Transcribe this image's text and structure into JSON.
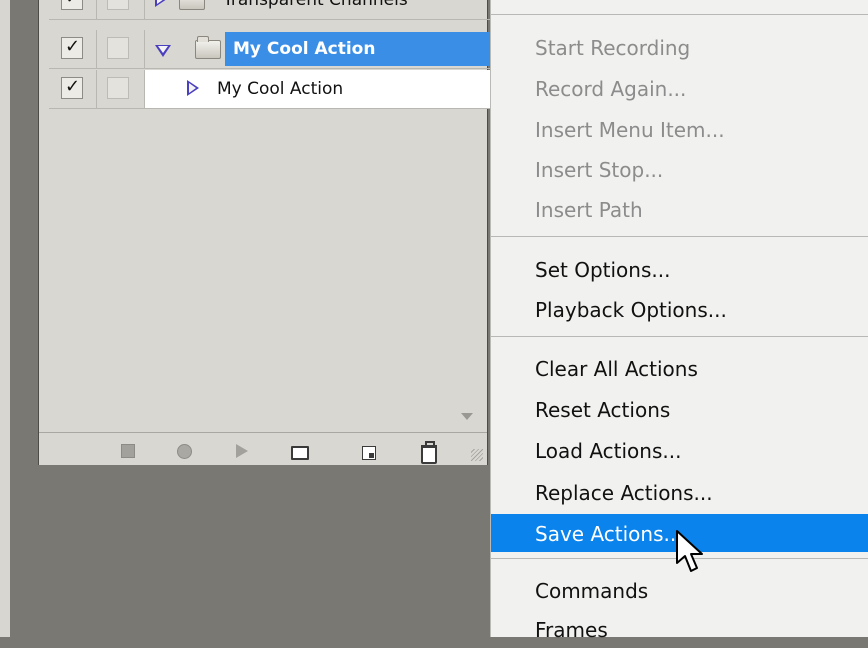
{
  "panel": {
    "rows": [
      {
        "label": "Transparent Channels",
        "checked": true
      },
      {
        "label": "My Cool Action",
        "checked": true,
        "selected": true
      },
      {
        "label": "My Cool Action",
        "checked": true
      }
    ],
    "checkmark": "✓",
    "toolbar_icons": [
      "stop-icon",
      "record-icon",
      "play-icon",
      "new-set-icon",
      "new-action-icon",
      "trash-icon"
    ]
  },
  "menu": {
    "items": [
      {
        "label": "Start Recording"
      },
      {
        "label": "Record Again..."
      },
      {
        "label": "Insert Menu Item..."
      },
      {
        "label": "Insert Stop..."
      },
      {
        "label": "Insert Path"
      },
      {
        "label": "Set Options..."
      },
      {
        "label": "Playback Options..."
      },
      {
        "label": "Clear All Actions"
      },
      {
        "label": "Reset Actions"
      },
      {
        "label": "Load Actions..."
      },
      {
        "label": "Replace Actions..."
      },
      {
        "label": "Save Actions..."
      },
      {
        "label": "Commands"
      },
      {
        "label": "Frames"
      }
    ],
    "highlighted": "Save Actions...",
    "highlight_color": "#0b83ec"
  },
  "colors": {
    "selection": "#3a8ee6",
    "disabled_text": "#8c8c8c"
  }
}
